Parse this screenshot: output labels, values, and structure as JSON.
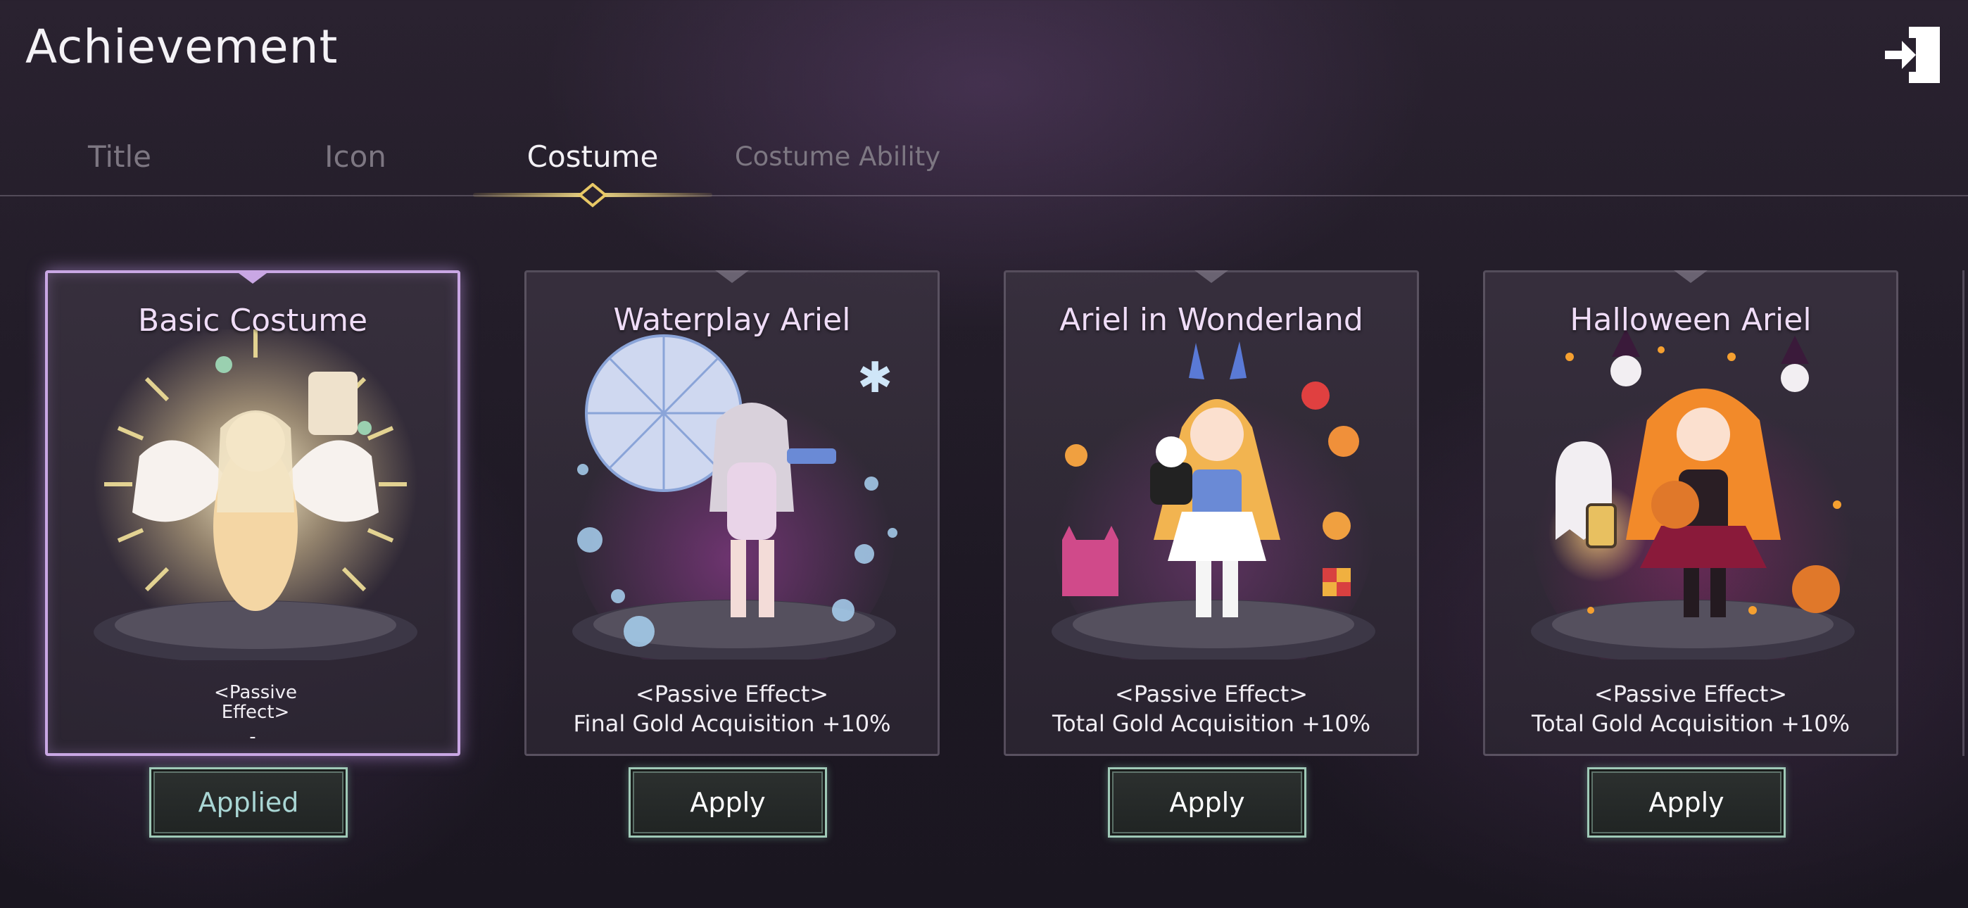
{
  "header": {
    "title": "Achievement"
  },
  "tabs": [
    {
      "label": "Title",
      "active": false
    },
    {
      "label": "Icon",
      "active": false
    },
    {
      "label": "Costume",
      "active": true
    },
    {
      "label": "Costume Ability",
      "active": false
    }
  ],
  "cards": [
    {
      "name": "Basic Costume",
      "effect_title": "<Passive Effect>",
      "effect_value": "-",
      "button": "Applied",
      "selected": true
    },
    {
      "name": "Waterplay Ariel",
      "effect_title": "<Passive Effect>",
      "effect_value": "Final Gold Acquisition +10%",
      "button": "Apply",
      "selected": false
    },
    {
      "name": "Ariel in Wonderland",
      "effect_title": "<Passive Effect>",
      "effect_value": "Total Gold Acquisition +10%",
      "button": "Apply",
      "selected": false
    },
    {
      "name": "Halloween Ariel",
      "effect_title": "<Passive Effect>",
      "effect_value": "Total Gold Acquisition +10%",
      "button": "Apply",
      "selected": false
    }
  ],
  "colors": {
    "accent_gold": "#e8c866",
    "selected_border": "#c9a7e4",
    "button_border": "#9fc9b7"
  },
  "icons": {
    "exit": "exit-door-icon"
  }
}
